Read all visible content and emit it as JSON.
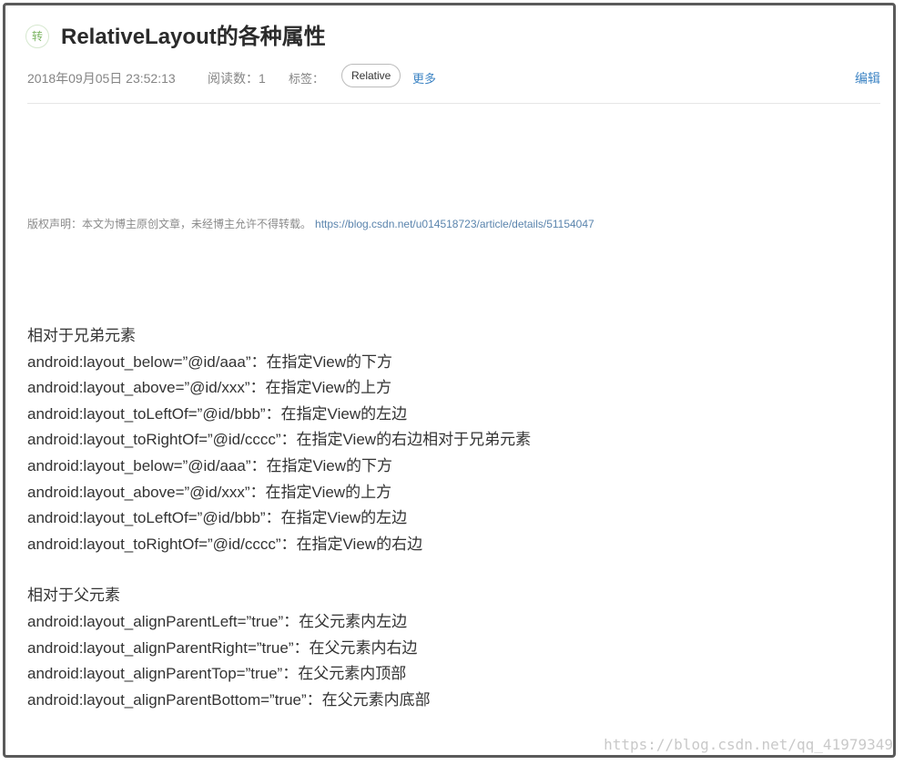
{
  "article": {
    "type_badge": "转",
    "title": "RelativeLayout的各种属性",
    "date": "2018年09月05日 23:52:13",
    "reads": "阅读数：1",
    "tags_label": "标签：",
    "tag": "Relative",
    "more": "更多",
    "edit": "编辑"
  },
  "copyright": {
    "text": "版权声明：本文为博主原创文章，未经博主允许不得转载。",
    "link": "https://blog.csdn.net/u014518723/article/details/51154047"
  },
  "content": {
    "section1_heading": "相对于兄弟元素",
    "section1_lines": [
      "android:layout_below=”@id/aaa”：在指定View的下方",
      "android:layout_above=”@id/xxx”：在指定View的上方",
      "android:layout_toLeftOf=”@id/bbb”：在指定View的左边",
      "android:layout_toRightOf=”@id/cccc”：在指定View的右边相对于兄弟元素",
      "android:layout_below=”@id/aaa”：在指定View的下方",
      "android:layout_above=”@id/xxx”：在指定View的上方",
      "android:layout_toLeftOf=”@id/bbb”：在指定View的左边",
      "android:layout_toRightOf=”@id/cccc”：在指定View的右边"
    ],
    "section2_heading": "相对于父元素",
    "section2_lines": [
      "android:layout_alignParentLeft=”true”：在父元素内左边",
      "android:layout_alignParentRight=”true”：在父元素内右边",
      "android:layout_alignParentTop=”true”：在父元素内顶部",
      "android:layout_alignParentBottom=”true”：在父元素内底部"
    ]
  },
  "watermark": "https://blog.csdn.net/qq_41979349"
}
